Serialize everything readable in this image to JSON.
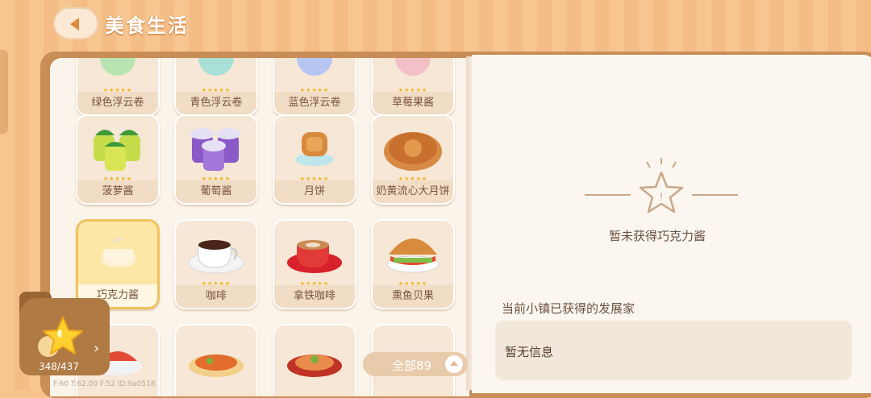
{
  "header": {
    "title": "美食生活"
  },
  "grid": {
    "items": [
      {
        "label": "绿色浮云卷",
        "stars": "★★★★★"
      },
      {
        "label": "青色浮云卷",
        "stars": "★★★★★"
      },
      {
        "label": "蓝色浮云卷",
        "stars": "★★★★★"
      },
      {
        "label": "草莓果酱",
        "stars": "★★★★★"
      },
      {
        "label": "菠萝酱",
        "stars": "★★★★★"
      },
      {
        "label": "葡萄酱",
        "stars": "★★★★★"
      },
      {
        "label": "月饼",
        "stars": "★★★★★"
      },
      {
        "label": "奶黄流心大月饼",
        "stars": "★★★★★"
      },
      {
        "label": "巧克力酱",
        "stars": "",
        "selected": true
      },
      {
        "label": "咖啡",
        "stars": "★★★★★"
      },
      {
        "label": "拿铁咖啡",
        "stars": "★★★★★"
      },
      {
        "label": "熏鱼贝果",
        "stars": "★★★★★"
      },
      {
        "label": "",
        "stars": ""
      },
      {
        "label": "",
        "stars": ""
      },
      {
        "label": "",
        "stars": ""
      },
      {
        "label": "",
        "stars": ""
      }
    ],
    "filter_label": "全部89"
  },
  "badge": {
    "count": "348/437",
    "arrow": "›"
  },
  "debug": "F:60  T:62.00  F:52  ID:9a0518",
  "detail": {
    "not_obtained": "暂未获得巧克力酱",
    "section_title": "当前小镇已获得的发展家",
    "info": "暂无信息"
  }
}
